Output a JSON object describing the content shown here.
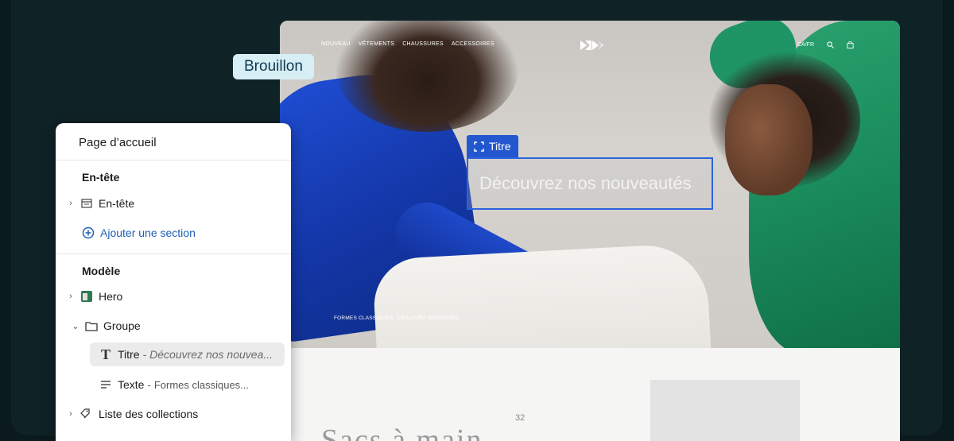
{
  "status_badge": "Brouillon",
  "storefront": {
    "nav_links": [
      "NOUVEAU",
      "VÊTEMENTS",
      "CHAUSSURES",
      "ACCESSOIRES"
    ],
    "locale": "CA/FR",
    "selected_block_label": "Titre",
    "hero_heading": "Découvrez nos nouveautés",
    "hero_caption": "FORMES CLASSIQUES, COULEURS MODERNES",
    "section_heading": "Sacs à main",
    "section_count": "32"
  },
  "sidebar": {
    "title": "Page d’accueil",
    "header_section": {
      "heading": "En-tête",
      "item": "En-tête",
      "add_label": "Ajouter une section"
    },
    "template_section": {
      "heading": "Modèle",
      "items": {
        "hero": "Hero",
        "group": "Groupe",
        "title_label": "Titre",
        "title_value": "Découvrez nos nouvea...",
        "text_label": "Texte",
        "text_value": "Formes classiques...",
        "collections": "Liste des collections"
      }
    }
  },
  "colors": {
    "selection_blue": "#2257d0",
    "link_blue": "#1e5fb3",
    "badge_bg": "#d8eef5"
  }
}
